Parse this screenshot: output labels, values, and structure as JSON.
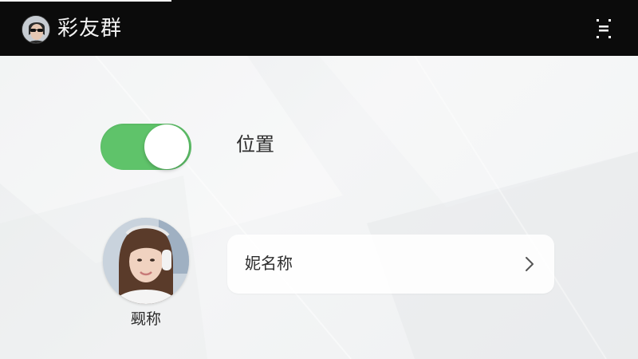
{
  "header": {
    "title": "彩友群",
    "avatar_icon": "sunglasses-avatar-icon",
    "menu_icon": "menu-icon"
  },
  "settings": {
    "location_toggle": {
      "label": "位置",
      "on": true,
      "color": "#5fc36a"
    },
    "profile": {
      "avatar_caption": "觋称",
      "nickname_label": "妮名称",
      "nickname_chevron_icon": "chevron-right-icon"
    }
  },
  "colors": {
    "topbar": "#0b0b0b",
    "background": "#f2f3f4",
    "toggle_on": "#5fc36a"
  }
}
